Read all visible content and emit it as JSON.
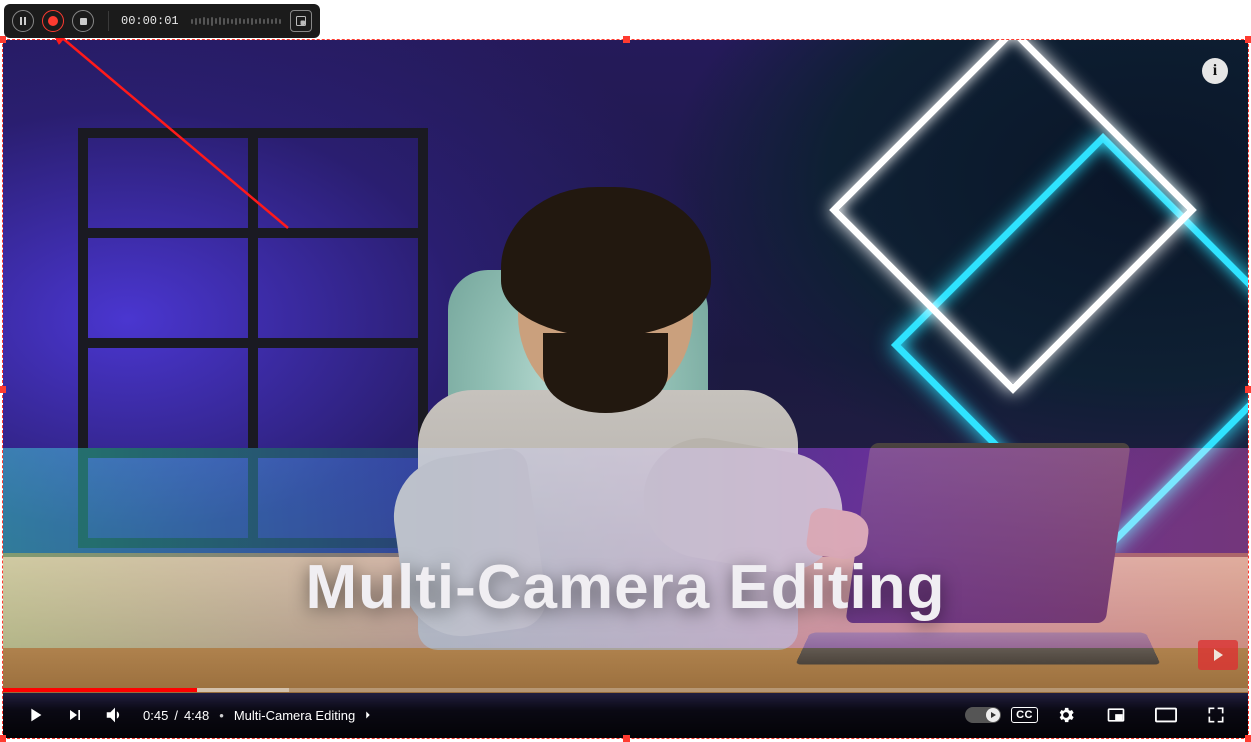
{
  "recorder": {
    "elapsed": "00:00:01",
    "waveform_bars": [
      3,
      5,
      4,
      6,
      5,
      7,
      4,
      6,
      5,
      4,
      3,
      5,
      4,
      3,
      4,
      5,
      3,
      4,
      3,
      4,
      3,
      4,
      3
    ]
  },
  "video": {
    "caption_overlay": "Multi-Camera Editing",
    "info_badge": "i",
    "progress": {
      "played_pct": 15.6,
      "buffered_pct": 23
    },
    "controls": {
      "current_time": "0:45",
      "duration": "4:48",
      "time_separator": " / ",
      "chapter_prefix": "",
      "chapter_title": "Multi-Camera Editing",
      "cc_label": "CC"
    }
  }
}
